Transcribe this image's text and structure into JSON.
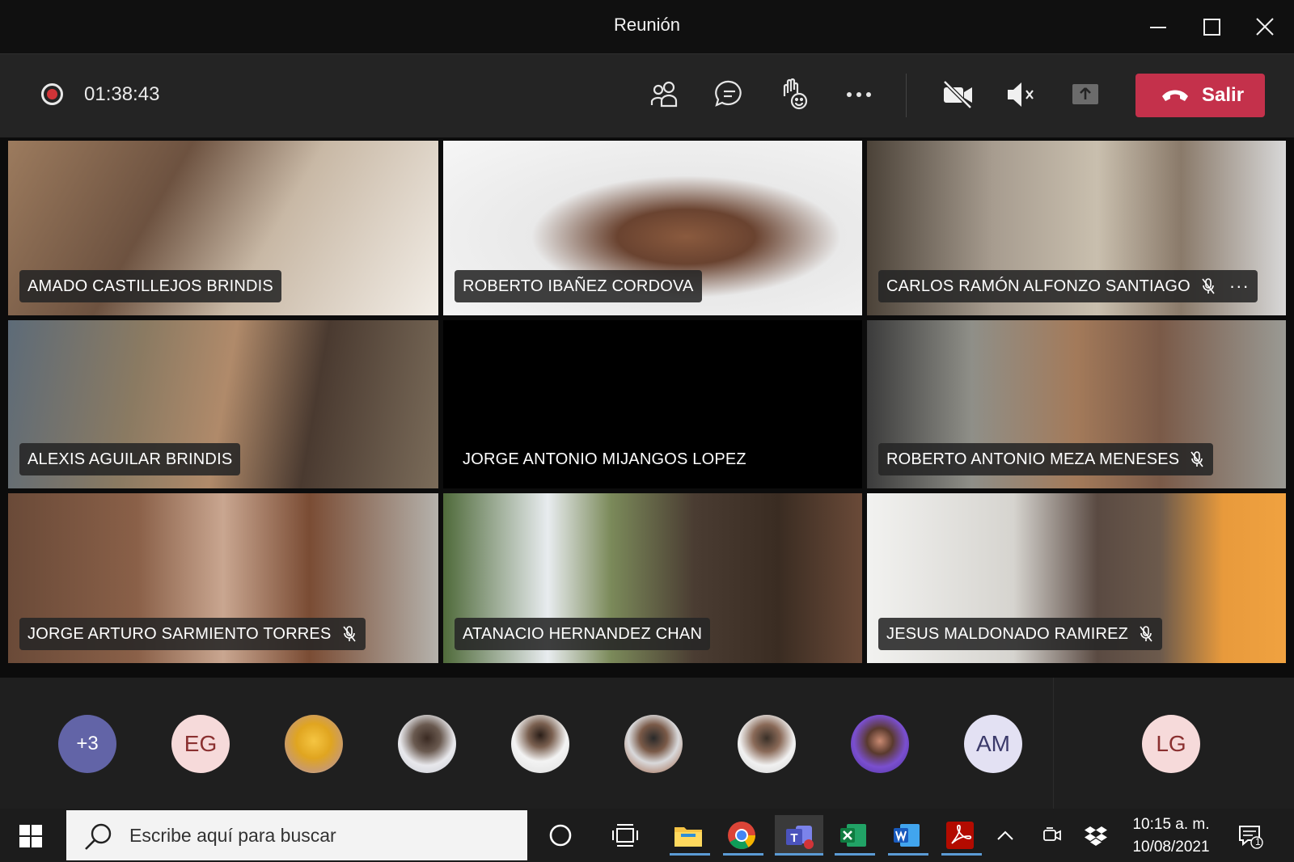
{
  "window": {
    "title": "Reunión"
  },
  "toolbar": {
    "timer": "01:38:43",
    "leave_label": "Salir",
    "icons": [
      "recording-indicator-icon",
      "participants-icon",
      "chat-icon",
      "raise-hand-icon",
      "more-options-icon",
      "camera-off-icon",
      "speaker-muted-icon",
      "share-tray-icon",
      "phone-hangup-icon"
    ]
  },
  "participants": [
    {
      "name": "AMADO CASTILLEJOS BRINDIS",
      "muted": false
    },
    {
      "name": "ROBERTO IBAÑEZ CORDOVA",
      "muted": false
    },
    {
      "name": "CARLOS RAMÓN ALFONZO SANTIAGO",
      "muted": true,
      "more": "···"
    },
    {
      "name": "ALEXIS AGUILAR BRINDIS",
      "muted": false
    },
    {
      "name": "JORGE ANTONIO MIJANGOS LOPEZ",
      "muted": false,
      "video_off": true
    },
    {
      "name": "ROBERTO ANTONIO MEZA MENESES",
      "muted": true
    },
    {
      "name": "JORGE ARTURO SARMIENTO TORRES",
      "muted": true
    },
    {
      "name": "ATANACIO HERNANDEZ CHAN",
      "muted": false
    },
    {
      "name": "JESUS MALDONADO RAMIREZ",
      "muted": true
    }
  ],
  "strip": {
    "overflow": "+3",
    "avatars": [
      {
        "initials": "EG"
      },
      {
        "initials": ""
      },
      {
        "initials": ""
      },
      {
        "initials": ""
      },
      {
        "initials": ""
      },
      {
        "initials": ""
      },
      {
        "initials": ""
      },
      {
        "initials": "AM"
      }
    ],
    "right_avatar": "LG"
  },
  "taskbar": {
    "search_placeholder": "Escribe aquí para buscar",
    "time": "10:15 a. m.",
    "date": "10/08/2021",
    "notification_count": "1"
  },
  "colors": {
    "accent_leave": "#c4314b",
    "recording": "#d13438",
    "overflow_avatar": "#6264a7"
  }
}
